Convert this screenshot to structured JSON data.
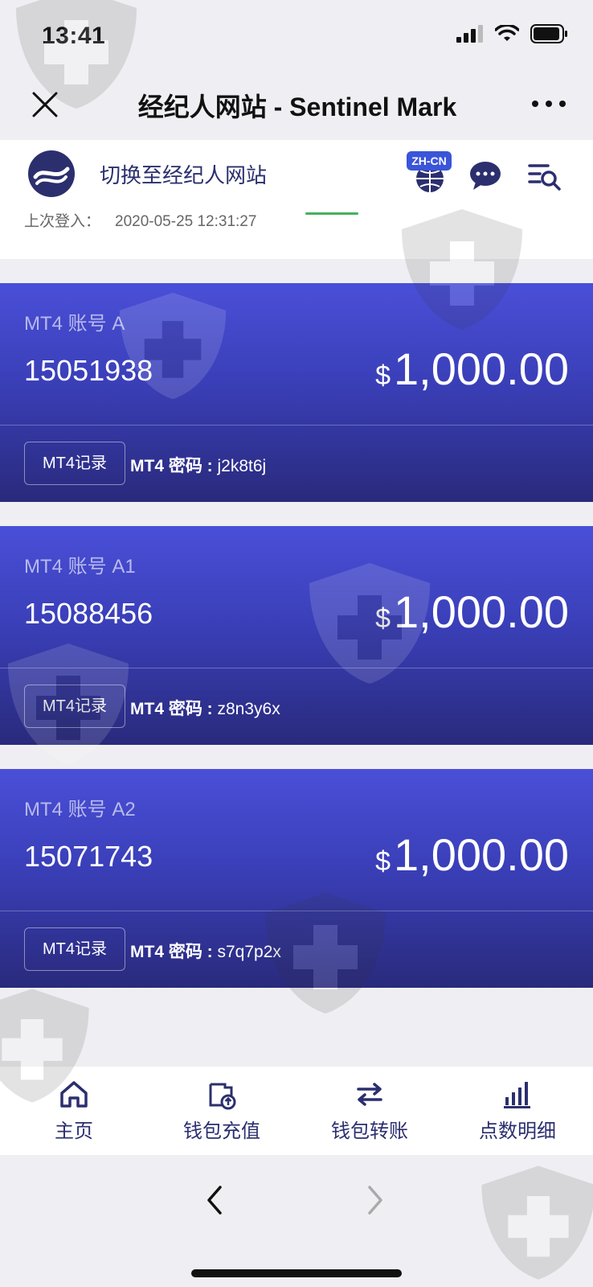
{
  "status_bar": {
    "time": "13:41"
  },
  "nav": {
    "title": "经纪人网站 - Sentinel Mark"
  },
  "header": {
    "switch_label": "切换至经纪人网站",
    "lang_badge": "ZH-CN",
    "last_login_label": "上次登入：",
    "last_login_value": "2020-05-25 12:31:27"
  },
  "accounts": [
    {
      "name": "MT4 账号 A",
      "id": "15051938",
      "currency": "$",
      "balance": "1,000.00",
      "record_button": "MT4记录",
      "password_label": "MT4 密码 : ",
      "password": "j2k8t6j"
    },
    {
      "name": "MT4 账号 A1",
      "id": "15088456",
      "currency": "$",
      "balance": "1,000.00",
      "record_button": "MT4记录",
      "password_label": "MT4 密码 : ",
      "password": "z8n3y6x"
    },
    {
      "name": "MT4 账号 A2",
      "id": "15071743",
      "currency": "$",
      "balance": "1,000.00",
      "record_button": "MT4记录",
      "password_label": "MT4 密码 : ",
      "password": "s7q7p2x"
    }
  ],
  "tabs": [
    {
      "label": "主页",
      "icon": "home-icon"
    },
    {
      "label": "钱包充值",
      "icon": "wallet-topup-icon"
    },
    {
      "label": "钱包转账",
      "icon": "transfer-arrows-icon"
    },
    {
      "label": "点数明细",
      "icon": "bar-chart-icon"
    }
  ],
  "colors": {
    "accent": "#2b2f6e",
    "card_top": "#4a4fd8",
    "card_bottom": "#292a7c",
    "green": "#44b15d"
  }
}
